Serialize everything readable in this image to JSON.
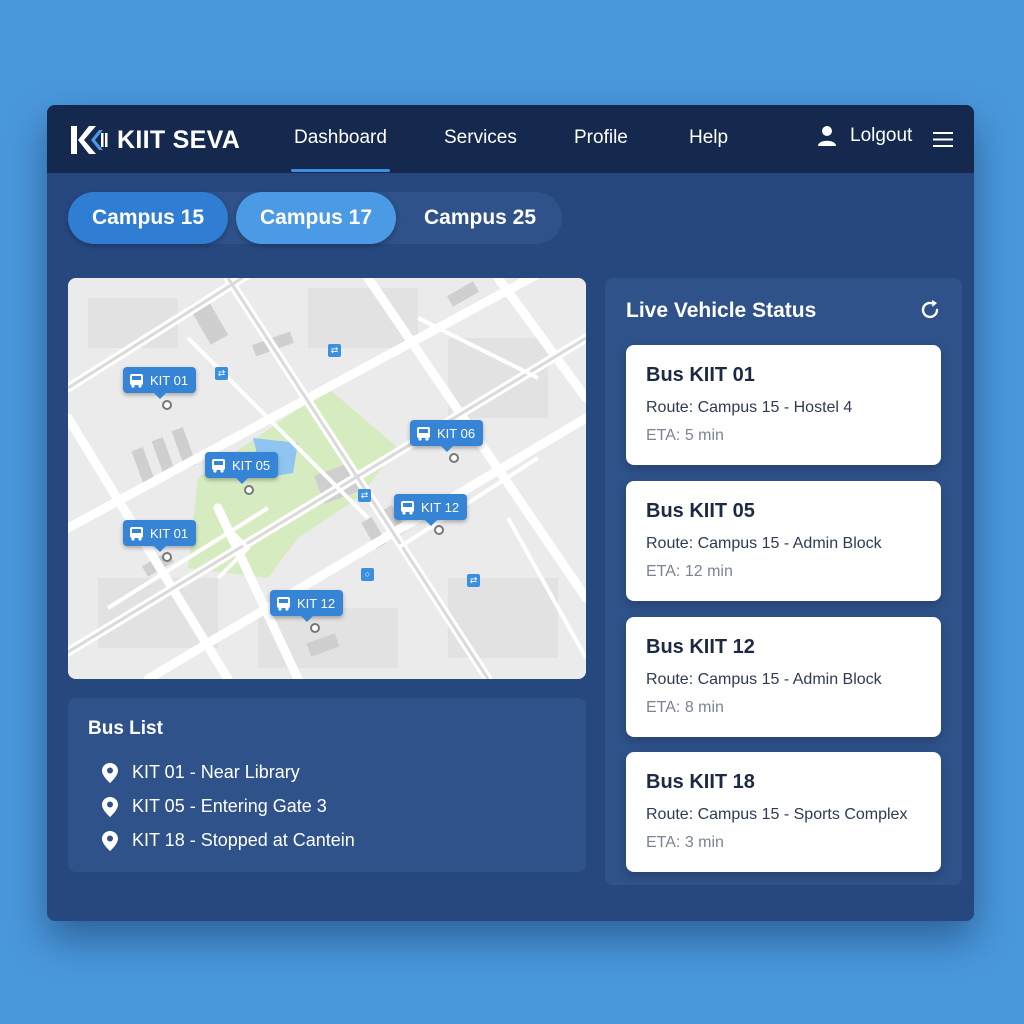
{
  "app": {
    "name": "KIIT SEVA"
  },
  "nav": {
    "links": [
      {
        "label": "Dashboard",
        "active": true
      },
      {
        "label": "Services",
        "active": false
      },
      {
        "label": "Profile",
        "active": false
      },
      {
        "label": "Help",
        "active": false
      }
    ],
    "logout_label": "Lolgout",
    "user_icon": "user-icon",
    "menu_icon": "hamburger-menu-icon"
  },
  "campus_tabs": [
    {
      "label": "Campus 15",
      "state": "selected"
    },
    {
      "label": "Campus 17",
      "state": "highlighted"
    },
    {
      "label": "Campus 25",
      "state": "default"
    }
  ],
  "map": {
    "markers": [
      {
        "label": "KIT 01"
      },
      {
        "label": "KIT 05"
      },
      {
        "label": "KIT 06"
      },
      {
        "label": "KIT 12"
      },
      {
        "label": "KIT 01"
      },
      {
        "label": "KIT 12"
      }
    ]
  },
  "bus_list": {
    "title": "Bus List",
    "items": [
      {
        "text": "KIT 01 - Near Library"
      },
      {
        "text": "KIT 05 - Entering Gate 3"
      },
      {
        "text": "KIT 18 - Stopped at Cantein"
      }
    ]
  },
  "live_status": {
    "title": "Live Vehicle Status",
    "refresh_icon": "refresh-icon",
    "cards": [
      {
        "bus": "Bus KIIT 01",
        "route": "Route: Campus 15 - Hostel 4",
        "eta": "ETA: 5 min"
      },
      {
        "bus": "Bus KIIT 05",
        "route": "Route: Campus 15 - Admin Block",
        "eta": "ETA: 12 min"
      },
      {
        "bus": "Bus KIIT 12",
        "route": "Route: Campus 15 - Admin Block",
        "eta": "ETA: 8 min"
      },
      {
        "bus": "Bus KIIT 18",
        "route": "Route: Campus 15 - Sports Complex",
        "eta": "ETA: 3 min"
      }
    ]
  },
  "colors": {
    "page_bg": "#4a98dc",
    "panel_bg": "#27477f",
    "navbar_bg": "#15284d",
    "accent": "#3584d6",
    "park_green": "#d6ecc0",
    "water_blue": "#8fc5f0"
  }
}
